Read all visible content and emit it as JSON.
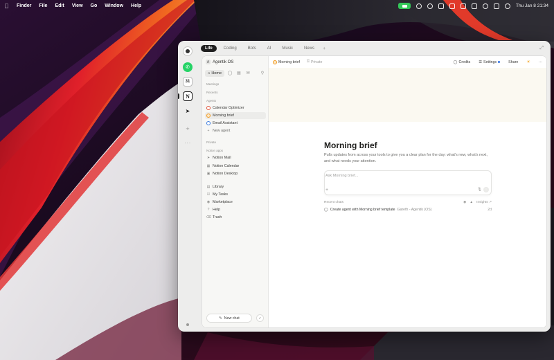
{
  "menubar": {
    "items": [
      "Finder",
      "File",
      "Edit",
      "View",
      "Go",
      "Window",
      "Help"
    ],
    "clock": "Thu Jan 8  21:34"
  },
  "app": {
    "tabs": [
      "Life",
      "Coding",
      "Bots",
      "AI",
      "Music",
      "News"
    ],
    "tab_add": "+",
    "rail_calendar": "31",
    "rail_notion": "N"
  },
  "sidebar": {
    "workspace": "Agentik OS",
    "home": "Home",
    "sections": {
      "meetings": "Meetings",
      "recents": "Recents",
      "agents": "Agents",
      "private": "Private",
      "notion_apps": "Notion apps"
    },
    "agents": [
      "Calendar Optimizer",
      "Morning brief",
      "Email Assistant",
      "New agent"
    ],
    "notion_apps": [
      "Notion Mail",
      "Notion Calendar",
      "Notion Desktop"
    ],
    "bottom": [
      "Library",
      "My Tasks",
      "Marketplace",
      "Help",
      "Trash"
    ],
    "new_chat": "New chat"
  },
  "main": {
    "breadcrumb": "Morning brief",
    "privacy": "Private",
    "credits": "Credits",
    "settings": "Settings",
    "share": "Share",
    "more": "···",
    "title": "Morning brief",
    "description": "Pulls updates from across your tools to give you a clear plan for the day: what's new, what's next, and what needs your attention.",
    "ask_placeholder": "Ask Morning brief...",
    "recent_label": "Recent chats",
    "insights": "Insights ↗",
    "recent_chat": {
      "title": "Create agent with Morning brief template",
      "by": "Gareth - Agentik (OS)",
      "when": "2d"
    }
  }
}
